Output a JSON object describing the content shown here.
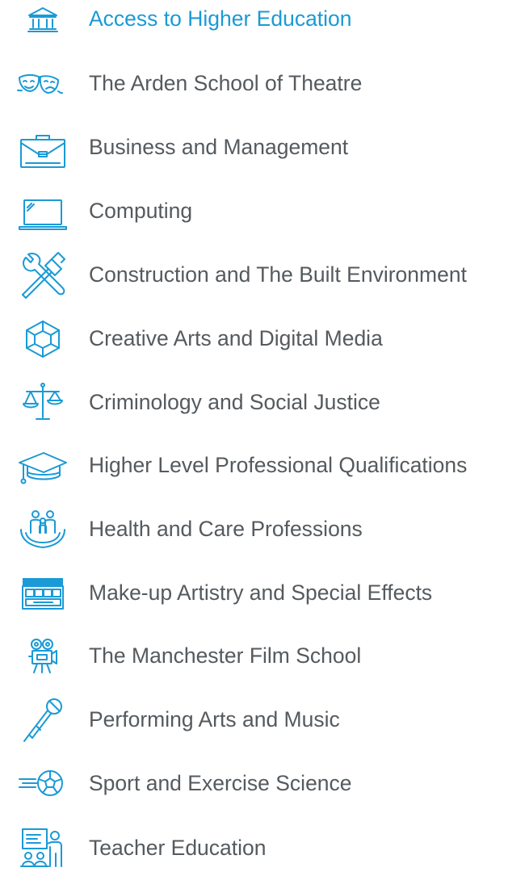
{
  "accent_color": "#1a9ad6",
  "text_color": "#555a5e",
  "subjects": [
    {
      "label": "Access to Higher Education",
      "icon": "university-building-icon"
    },
    {
      "label": "The Arden School of Theatre",
      "icon": "theatre-masks-icon"
    },
    {
      "label": "Business and Management",
      "icon": "briefcase-icon"
    },
    {
      "label": "Computing",
      "icon": "laptop-icon"
    },
    {
      "label": "Construction and The Built Environment",
      "icon": "hammer-wrench-icon"
    },
    {
      "label": "Creative Arts and Digital Media",
      "icon": "cube-icon"
    },
    {
      "label": "Criminology and Social Justice",
      "icon": "scales-of-justice-icon"
    },
    {
      "label": "Higher Level Professional Qualifications",
      "icon": "graduation-cap-icon"
    },
    {
      "label": "Health and Care Professions",
      "icon": "family-hands-icon"
    },
    {
      "label": "Make-up Artistry and Special Effects",
      "icon": "makeup-palette-icon"
    },
    {
      "label": "The Manchester Film School",
      "icon": "film-camera-icon"
    },
    {
      "label": "Performing Arts and Music",
      "icon": "microphone-icon"
    },
    {
      "label": "Sport and Exercise Science",
      "icon": "football-icon"
    },
    {
      "label": "Teacher Education",
      "icon": "teacher-board-icon"
    }
  ]
}
